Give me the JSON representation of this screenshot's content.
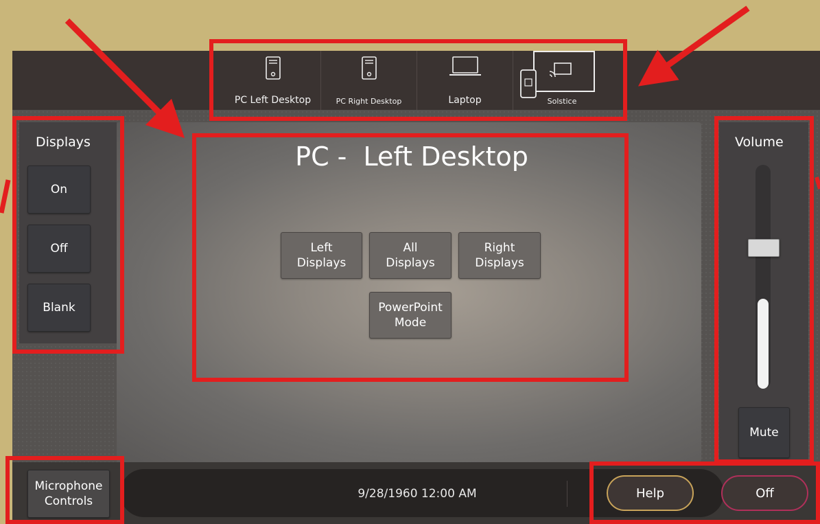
{
  "sources": [
    {
      "label": "PC Left Desktop",
      "icon": "desktop-tower-icon"
    },
    {
      "label": "PC Right Desktop",
      "icon": "desktop-tower-icon"
    },
    {
      "label": "Laptop",
      "icon": "laptop-icon"
    },
    {
      "label": "Solstice",
      "icon": "cast-screen-icon"
    }
  ],
  "displays": {
    "title": "Displays",
    "on_label": "On",
    "off_label": "Off",
    "blank_label": "Blank"
  },
  "stage": {
    "title": "PC -  Left Desktop",
    "left_displays": "Left\nDisplays",
    "all_displays": "All\nDisplays",
    "right_displays": "Right\nDisplays",
    "powerpoint_mode": "PowerPoint\nMode"
  },
  "volume": {
    "title": "Volume",
    "level": 0.42,
    "mute_label": "Mute"
  },
  "footer": {
    "microphone_label": "Microphone\nControls",
    "datetime": "9/28/1960 12:00 AM",
    "help_label": "Help",
    "off_label": "Off"
  },
  "colors": {
    "annotation_red": "#e31e1e",
    "help_border": "#c9a45a",
    "off_border": "#b0305a",
    "background_tan": "#c9b67a"
  }
}
